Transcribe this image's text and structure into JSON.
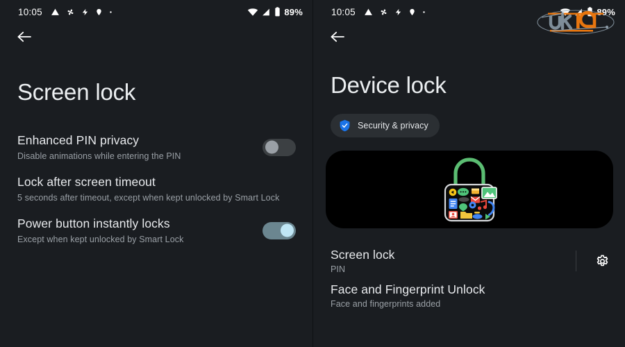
{
  "left_panel": {
    "statusbar": {
      "time": "10:05",
      "icons": [
        "warning-triangle-icon",
        "fan-icon",
        "bolt-icon",
        "location-pin-icon",
        "dot-icon"
      ],
      "wifi_icon": "wifi-icon",
      "signal_icon": "cell-signal-icon",
      "battery_icon": "battery-icon",
      "battery_text": "89%"
    },
    "back_icon": "back-arrow-icon",
    "title": "Screen lock",
    "rows": [
      {
        "title": "Enhanced PIN privacy",
        "subtitle": "Disable animations while entering the PIN",
        "control": "toggle",
        "state": "off"
      },
      {
        "title": "Lock after screen timeout",
        "subtitle": "5 seconds after timeout, except when kept unlocked by Smart Lock",
        "control": "none",
        "state": ""
      },
      {
        "title": "Power button instantly locks",
        "subtitle": "Except when kept unlocked by Smart Lock",
        "control": "toggle",
        "state": "on"
      }
    ]
  },
  "right_panel": {
    "statusbar": {
      "time": "10:05",
      "icons": [
        "warning-triangle-icon",
        "fan-icon",
        "bolt-icon",
        "location-pin-icon",
        "dot-icon"
      ],
      "wifi_icon": "wifi-icon",
      "signal_icon": "cell-signal-icon",
      "battery_icon": "battery-icon",
      "battery_text": "89%"
    },
    "back_icon": "back-arrow-icon",
    "title": "Device lock",
    "chip": {
      "label": "Security & privacy",
      "icon": "shield-check-icon"
    },
    "hero": {
      "illustration": "padlock-with-app-icons-illustration"
    },
    "rows": [
      {
        "title": "Screen lock",
        "subtitle": "PIN",
        "action_icon": "gear-icon",
        "has_divider": true
      },
      {
        "title": "Face and Fingerprint Unlock",
        "subtitle": "Face and fingerprints added",
        "action_icon": "",
        "has_divider": false
      }
    ],
    "watermark": "ur19-logo-watermark"
  },
  "colors": {
    "background": "#1a1d21",
    "card": "#000000",
    "accent_blue": "#1a73e8",
    "toggle_on_track": "#6b8690",
    "toggle_on_knob": "#bfe6f5",
    "toggle_off_track": "#3c4043",
    "toggle_off_knob": "#9aa0a6",
    "lock_green": "#5bbd72",
    "watermark_orange": "#e8760f",
    "watermark_gray": "#7e8d99"
  }
}
